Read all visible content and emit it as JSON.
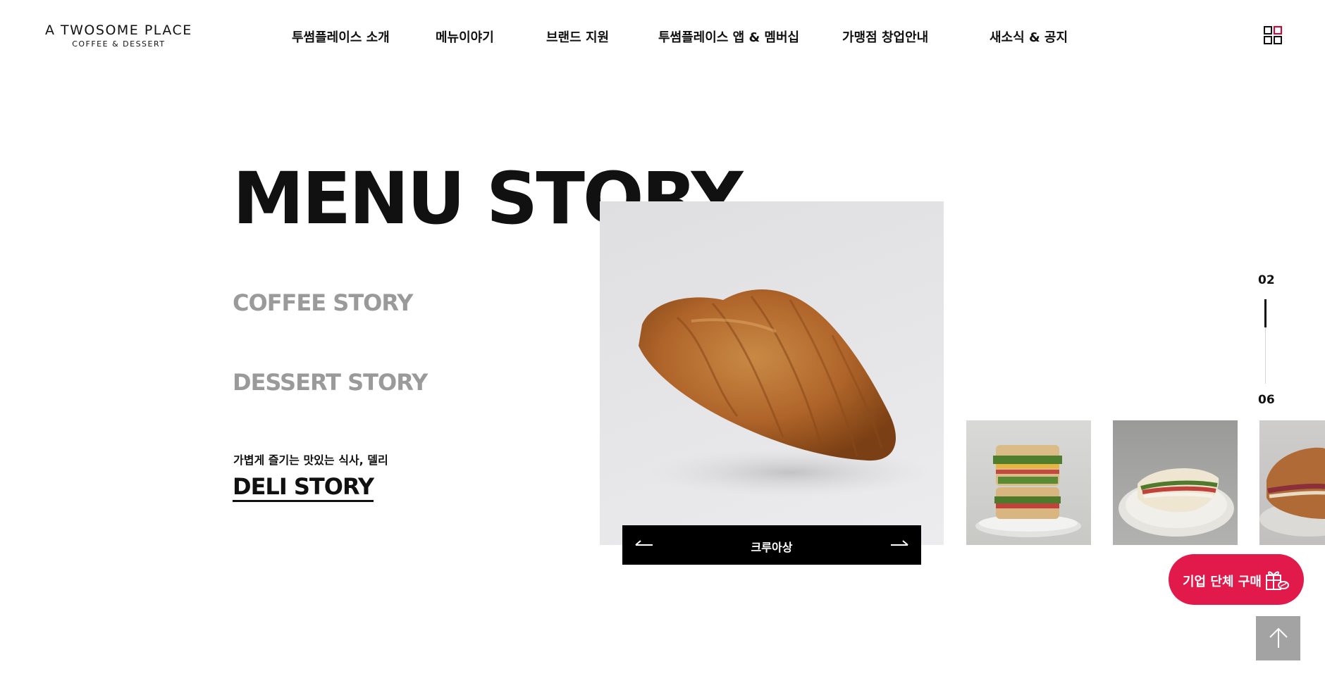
{
  "header": {
    "logo_main": "A TWOSOME PLACE",
    "logo_sub": "COFFEE & DESSERT",
    "nav": [
      {
        "label": "투썸플레이스 소개"
      },
      {
        "label": "메뉴이야기"
      },
      {
        "label": "브랜드 지원"
      },
      {
        "label": "투썸플레이스 앱 & 멤버십"
      },
      {
        "label": "가맹점 창업안내"
      },
      {
        "label": "새소식 & 공지"
      }
    ],
    "menu_icon": "grid-menu-icon",
    "accent_color": "#e1002d"
  },
  "main": {
    "title": "MENU STORY",
    "stories": [
      {
        "label": "COFFEE STORY"
      },
      {
        "label": "DESSERT STORY"
      },
      {
        "label": "DELI STORY",
        "subtitle": "가볍게 즐기는 맛있는 식사, 델리"
      }
    ]
  },
  "slider": {
    "current_item": "크루아상",
    "prev_icon": "arrow-left-icon",
    "next_icon": "arrow-right-icon",
    "thumbnails": [
      {
        "name": "sandwich-stack-thumbnail"
      },
      {
        "name": "panini-thumbnail"
      },
      {
        "name": "bagel-sandwich-thumbnail"
      }
    ],
    "pager": {
      "current": "02",
      "total": "06"
    }
  },
  "floating": {
    "corp_purchase_label": "기업 단체 구매",
    "corp_icon": "gift-coffee-icon",
    "corp_color": "#e21a4c",
    "top_icon": "arrow-up-icon"
  }
}
